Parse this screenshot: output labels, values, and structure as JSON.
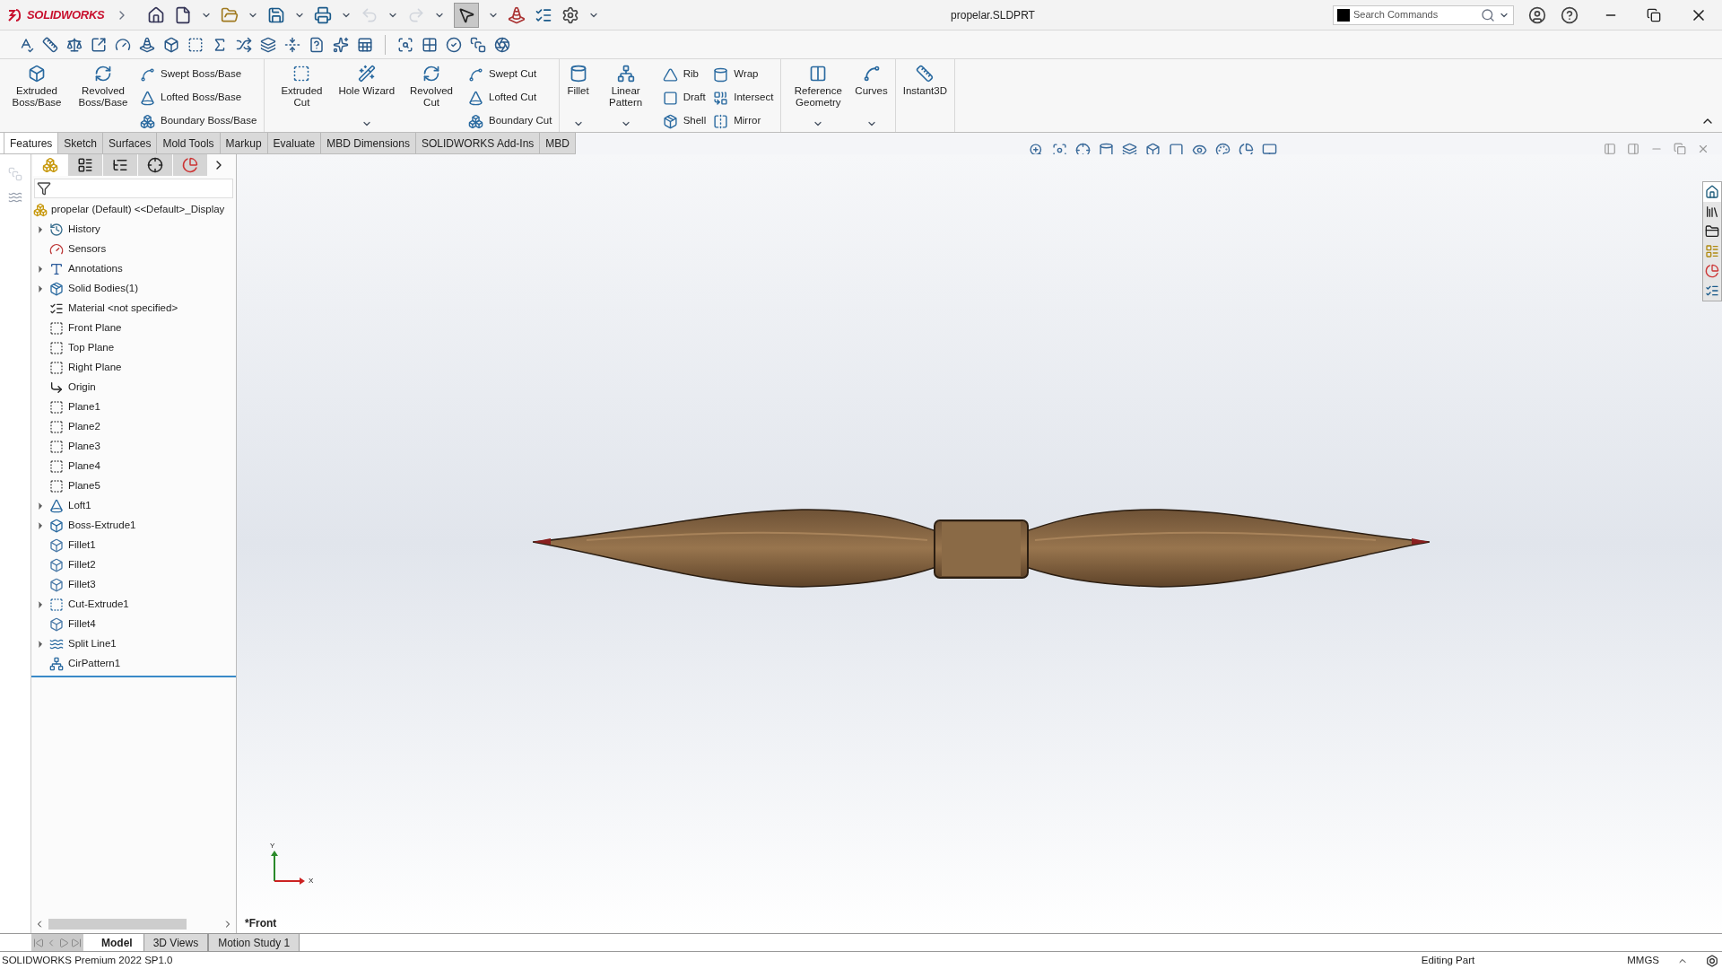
{
  "app": {
    "logo_text": "SOLIDWORKS",
    "title": "propelar.SLDPRT"
  },
  "search": {
    "placeholder": "Search Commands"
  },
  "ribbon": {
    "groups": [
      {
        "items": [
          {
            "kind": "large",
            "label": "Extruded Boss/Base",
            "has_menu": false
          },
          {
            "kind": "large",
            "label": "Revolved Boss/Base",
            "has_menu": false
          },
          {
            "kind": "stack",
            "items": [
              {
                "label": "Swept Boss/Base"
              },
              {
                "label": "Lofted Boss/Base"
              },
              {
                "label": "Boundary Boss/Base"
              }
            ]
          }
        ]
      },
      {
        "items": [
          {
            "kind": "large",
            "label": "Extruded Cut",
            "has_menu": false
          },
          {
            "kind": "large",
            "label": "Hole Wizard",
            "has_menu": true
          },
          {
            "kind": "large",
            "label": "Revolved Cut",
            "has_menu": false
          },
          {
            "kind": "stack",
            "items": [
              {
                "label": "Swept Cut"
              },
              {
                "label": "Lofted Cut"
              },
              {
                "label": "Boundary Cut"
              }
            ]
          }
        ]
      },
      {
        "items": [
          {
            "kind": "large",
            "label": "Fillet",
            "has_menu": true
          },
          {
            "kind": "large",
            "label": "Linear Pattern",
            "has_menu": true
          },
          {
            "kind": "stack",
            "items": [
              {
                "label": "Rib"
              },
              {
                "label": "Draft"
              },
              {
                "label": "Shell"
              }
            ]
          },
          {
            "kind": "stack",
            "items": [
              {
                "label": "Wrap"
              },
              {
                "label": "Intersect"
              },
              {
                "label": "Mirror"
              }
            ]
          }
        ]
      },
      {
        "items": [
          {
            "kind": "large",
            "label": "Reference Geometry",
            "has_menu": true
          },
          {
            "kind": "large",
            "label": "Curves",
            "has_menu": true
          }
        ]
      },
      {
        "items": [
          {
            "kind": "large",
            "label": "Instant3D",
            "has_menu": false
          }
        ]
      }
    ]
  },
  "command_tabs": [
    {
      "label": "Features",
      "selected": true
    },
    {
      "label": "Sketch",
      "selected": false
    },
    {
      "label": "Surfaces",
      "selected": false
    },
    {
      "label": "Mold Tools",
      "selected": false
    },
    {
      "label": "Markup",
      "selected": false
    },
    {
      "label": "Evaluate",
      "selected": false
    },
    {
      "label": "MBD Dimensions",
      "selected": false
    },
    {
      "label": "SOLIDWORKS Add-Ins",
      "selected": false
    },
    {
      "label": "MBD",
      "selected": false
    }
  ],
  "panel_tabs": [
    {
      "selected": true
    },
    {
      "selected": false
    },
    {
      "selected": false
    },
    {
      "selected": false
    },
    {
      "selected": false
    }
  ],
  "tree": {
    "root": "propelar (Default) <<Default>_Display",
    "items": [
      {
        "label": "History",
        "kind": "history",
        "expandable": true
      },
      {
        "label": "Sensors",
        "kind": "sensors",
        "expandable": false
      },
      {
        "label": "Annotations",
        "kind": "annotations",
        "expandable": true
      },
      {
        "label": "Solid Bodies(1)",
        "kind": "bodies",
        "expandable": true
      },
      {
        "label": "Material <not specified>",
        "kind": "material",
        "expandable": false
      },
      {
        "label": "Front Plane",
        "kind": "plane",
        "expandable": false
      },
      {
        "label": "Top Plane",
        "kind": "plane",
        "expandable": false
      },
      {
        "label": "Right Plane",
        "kind": "plane",
        "expandable": false
      },
      {
        "label": "Origin",
        "kind": "origin",
        "expandable": false
      },
      {
        "label": "Plane1",
        "kind": "plane",
        "expandable": false
      },
      {
        "label": "Plane2",
        "kind": "plane",
        "expandable": false
      },
      {
        "label": "Plane3",
        "kind": "plane",
        "expandable": false
      },
      {
        "label": "Plane4",
        "kind": "plane",
        "expandable": false
      },
      {
        "label": "Plane5",
        "kind": "plane",
        "expandable": false
      },
      {
        "label": "Loft1",
        "kind": "loft",
        "expandable": true
      },
      {
        "label": "Boss-Extrude1",
        "kind": "extrude",
        "expandable": true
      },
      {
        "label": "Fillet1",
        "kind": "fillet",
        "expandable": false
      },
      {
        "label": "Fillet2",
        "kind": "fillet",
        "expandable": false
      },
      {
        "label": "Fillet3",
        "kind": "fillet",
        "expandable": false
      },
      {
        "label": "Cut-Extrude1",
        "kind": "cut",
        "expandable": true
      },
      {
        "label": "Fillet4",
        "kind": "fillet",
        "expandable": false
      },
      {
        "label": "Split Line1",
        "kind": "split",
        "expandable": true
      },
      {
        "label": "CirPattern1",
        "kind": "pattern",
        "expandable": false
      }
    ]
  },
  "viewport": {
    "view_name": "*Front",
    "triad_y": "Y",
    "triad_x": "X"
  },
  "bottom_tabs": [
    {
      "label": "Model",
      "selected": true
    },
    {
      "label": "3D Views",
      "selected": false
    },
    {
      "label": "Motion Study 1",
      "selected": false
    }
  ],
  "status_bar": {
    "product": "SOLIDWORKS Premium 2022 SP1.0",
    "mode": "Editing Part",
    "units": "MMGS"
  }
}
